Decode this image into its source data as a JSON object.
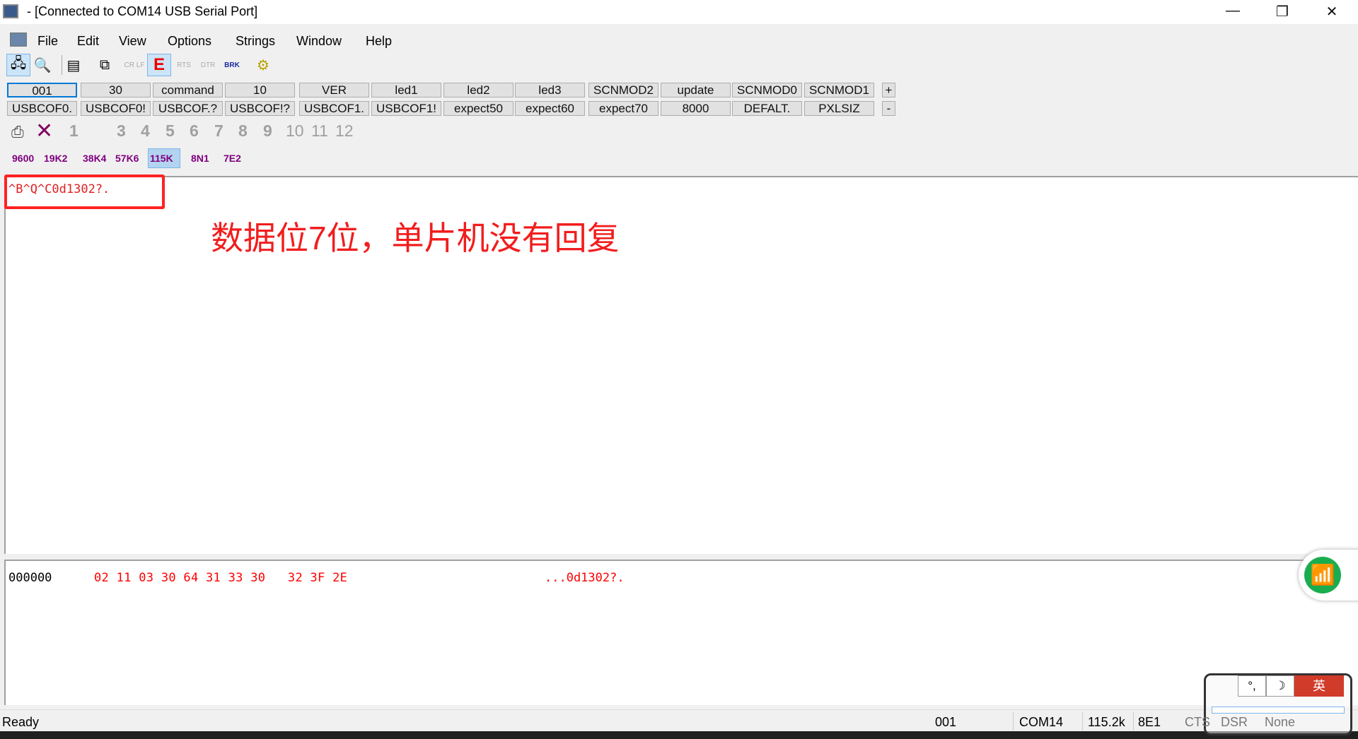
{
  "window": {
    "title": "- [Connected to COM14   USB Serial Port]",
    "minimize": "—",
    "restore": "❐",
    "close": "✕"
  },
  "menu": [
    "File",
    "Edit",
    "View",
    "Options",
    "Strings",
    "Window",
    "Help"
  ],
  "toolbar": {
    "icons": [
      "connect-icon",
      "disconnect-icon",
      "document-icon",
      "copy-icon",
      "crlf-icon",
      "echo-icon",
      "rts-icon",
      "dtr-icon",
      "break-icon",
      "settings-gear-icon"
    ],
    "crlf": "CR LF",
    "echo": "E",
    "rts": "RTS",
    "dtr": "DTR",
    "brk": "BRK"
  },
  "macros": {
    "row1": [
      "001",
      "30",
      "command",
      "10",
      "VER",
      "led1",
      "led2",
      "led3",
      "SCNMOD2",
      "update",
      "SCNMOD0",
      "SCNMOD1"
    ],
    "row2": [
      "USBCOF0.",
      "USBCOF0!",
      "USBCOF.?",
      "USBCOF!?",
      "USBCOF1.",
      "USBCOF1!",
      "expect50",
      "expect60",
      "expect70",
      "8000",
      "DEFALT.",
      "PXLSIZ"
    ],
    "plus": "+",
    "minus": "-"
  },
  "numbers": [
    "1",
    "3",
    "4",
    "5",
    "6",
    "7",
    "8",
    "9",
    "10",
    "11",
    "12"
  ],
  "baud": [
    "9600",
    "19K2",
    "38K4",
    "57K6",
    "115K",
    "8N1",
    "7E2"
  ],
  "terminal": {
    "line": "^B^Q^C0d1302?.",
    "annotation": "数据位7位，单片机没有回复"
  },
  "hex": {
    "offset": "000000",
    "bytes": "02 11 03 30 64 31 33 30   32 3F 2E",
    "ascii": "...0d1302?."
  },
  "status": {
    "ready": "Ready",
    "macro": "001",
    "port": "COM14",
    "baud": "115.2k",
    "format": "8E1",
    "cts": "CTS",
    "dsr": "DSR",
    "none": "None"
  },
  "ime": {
    "lang": "英"
  },
  "colors": {
    "accent": "#0078d7",
    "red": "#ff0000",
    "purple": "#800080"
  }
}
